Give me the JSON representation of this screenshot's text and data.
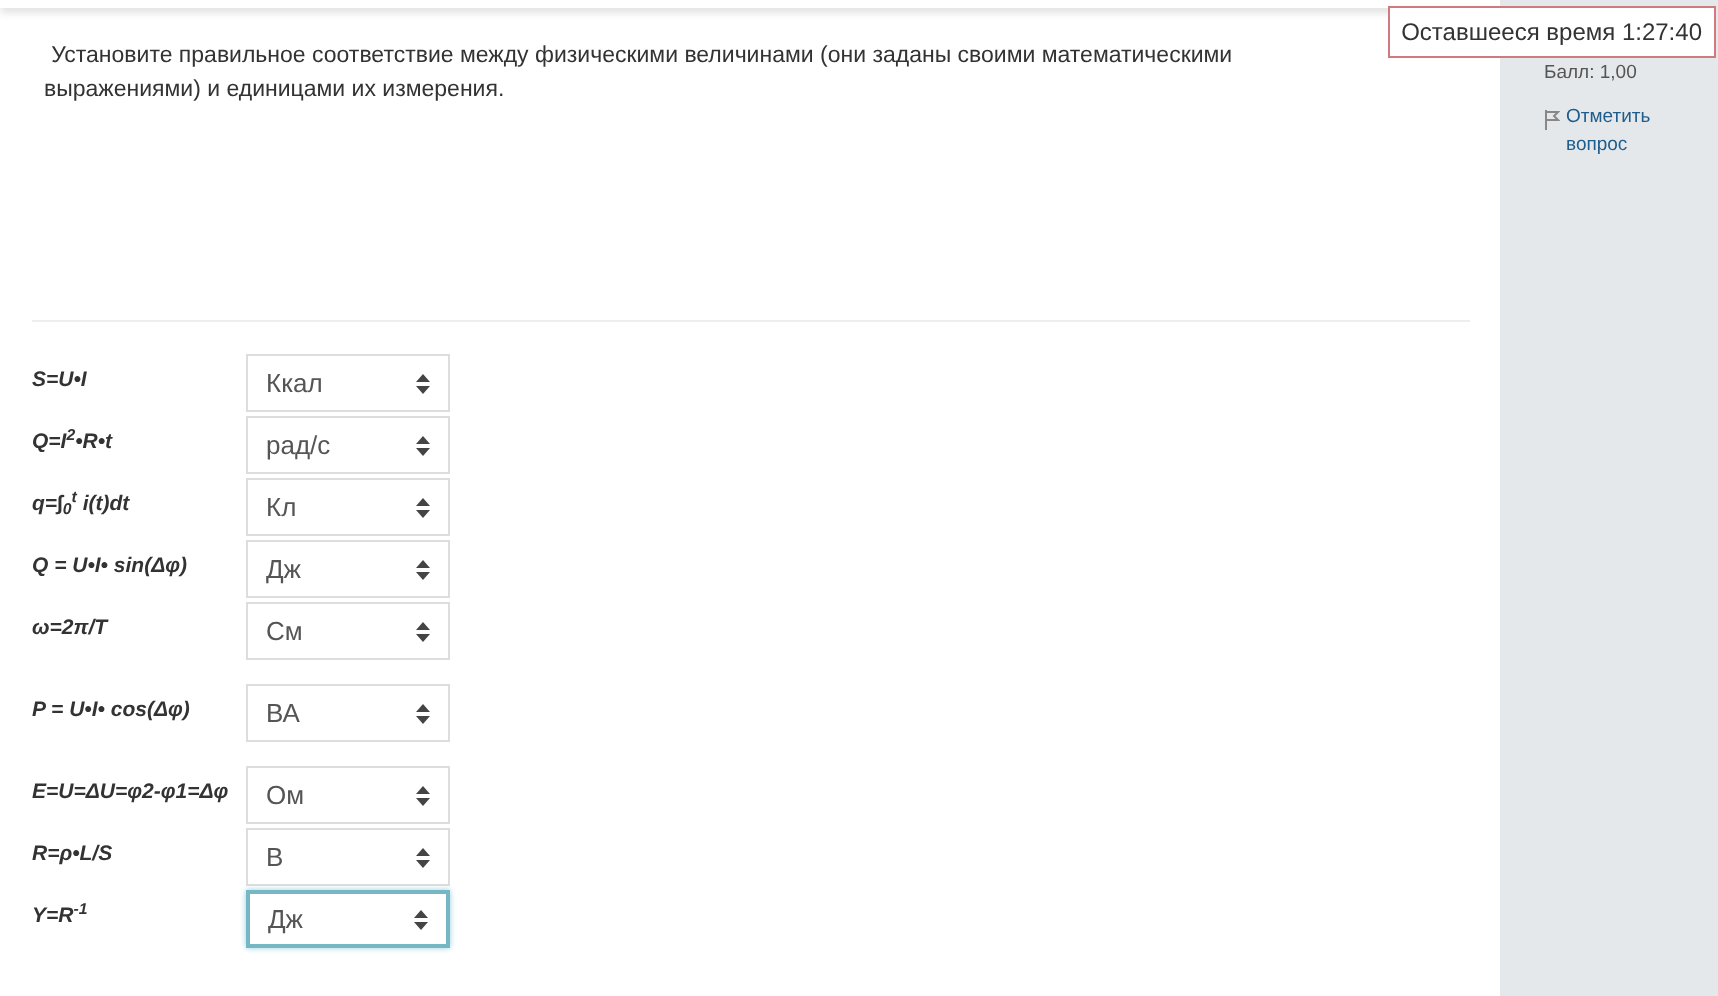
{
  "question": {
    "text": "Установите правильное соответствие между физическими величинами (они заданы своими математическими  выражениями) и единицами их измерения."
  },
  "timer": {
    "label": "Оставшееся время 1:27:40"
  },
  "info": {
    "score": "Балл: 1,00",
    "flag_label": "Отметить вопрос"
  },
  "rows": [
    {
      "formula": "S=U•I",
      "value": "Ккал",
      "focused": false
    },
    {
      "formula": "Q=I$^{2}$•R•t",
      "value": "рад/с",
      "focused": false
    },
    {
      "formula": "q=∫$_{0}$$^{t}$ *i*(*t*)*dt*",
      "value": "Кл",
      "focused": false
    },
    {
      "formula": "Q = U•I• sin(Δφ)",
      "value": "Дж",
      "focused": false
    },
    {
      "formula": "ω=2π/T",
      "value": "См",
      "focused": false
    },
    {
      "formula": "P = U•I• cos(Δφ)",
      "value": "ВА",
      "focused": false
    },
    {
      "formula": "E=U=ΔU=φ2-φ1=Δφ",
      "value": "Ом",
      "focused": false
    },
    {
      "formula": "R=ρ•L/S",
      "value": "В",
      "focused": false
    },
    {
      "formula": "Y=R$^{-1}$",
      "value": "Дж",
      "focused": true
    }
  ]
}
